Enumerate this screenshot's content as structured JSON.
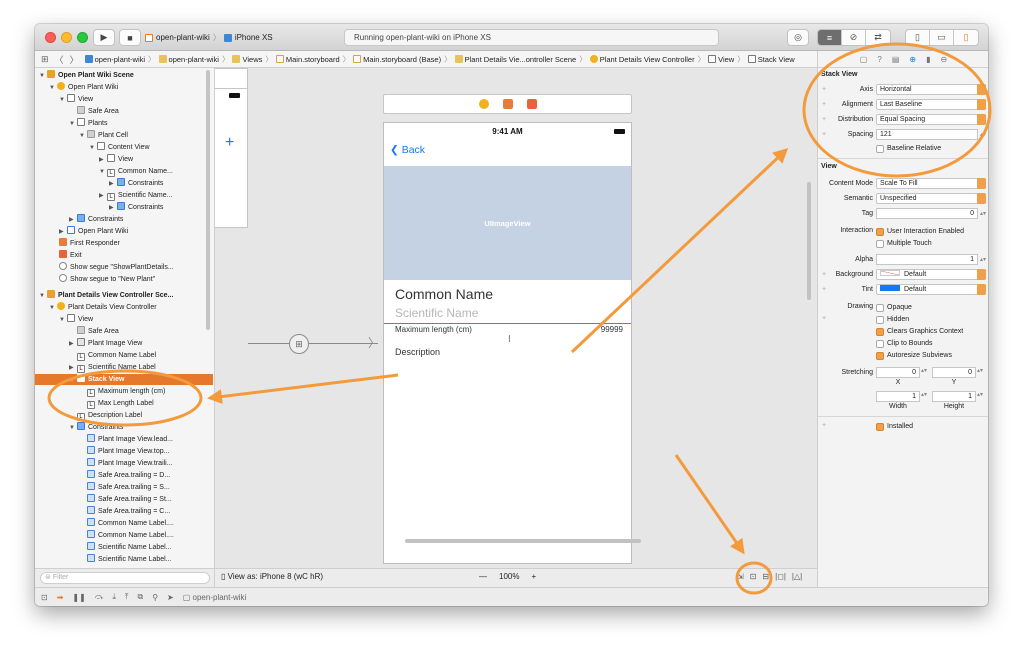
{
  "toolbar": {
    "scheme": "open-plant-wiki",
    "device": "iPhone XS",
    "status": "Running open-plant-wiki on iPhone XS"
  },
  "jumpbar": {
    "crumbs": [
      "open-plant-wiki",
      "open-plant-wiki",
      "Views",
      "Main.storyboard",
      "Main.storyboard (Base)",
      "Plant Details Vie...ontroller Scene",
      "Plant Details View Controller",
      "View",
      "Stack View"
    ]
  },
  "outline": {
    "rows": [
      "Open Plant Wiki Scene",
      "Open Plant Wiki",
      "View",
      "Safe Area",
      "Plants",
      "Plant Cell",
      "Content View",
      "View",
      "Common Name...",
      "Constraints",
      "Scientific Name...",
      "Constraints",
      "Constraints",
      "Open Plant Wiki",
      "First Responder",
      "Exit",
      "Show segue \"ShowPlantDetails...",
      "Show segue to \"New Plant\"",
      "Plant Details View Controller Sce...",
      "Plant Details View Controller",
      "View",
      "Safe Area",
      "Plant Image View",
      "Common Name Label",
      "Scientific Name Label",
      "Stack View",
      "Maximum length (cm)",
      "Max Length Label",
      "Description Label",
      "Constraints",
      "Plant Image View.lead...",
      "Plant Image View.top...",
      "Plant Image View.traili...",
      "Safe Area.trailing = D...",
      "Safe Area.trailing = S...",
      "Safe Area.trailing = St...",
      "Safe Area.trailing = C...",
      "Common Name Label....",
      "Common Name Label....",
      "Scientific Name Label...",
      "Scientific Name Label..."
    ],
    "filter_placeholder": "Filter"
  },
  "canvas": {
    "status_time": "9:41 AM",
    "back_label": "Back",
    "image_placeholder": "UIImageView",
    "common_name": "Common Name",
    "scientific_name": "Scientific Name",
    "max_length_label": "Maximum length (cm)",
    "max_length_value": "99999",
    "description": "Description",
    "view_as": "View as: iPhone 8 (wC hR)",
    "zoom": "100%",
    "zoom_minus": "—",
    "zoom_plus": "+"
  },
  "debug": {
    "target": "open-plant-wiki"
  },
  "inspector": {
    "stack_title": "Stack View",
    "axis_label": "Axis",
    "axis_value": "Horizontal",
    "alignment_label": "Alignment",
    "alignment_value": "Last Baseline",
    "distribution_label": "Distribution",
    "distribution_value": "Equal Spacing",
    "spacing_label": "Spacing",
    "spacing_value": "121",
    "baseline_relative": "Baseline Relative",
    "view_title": "View",
    "content_mode_label": "Content Mode",
    "content_mode_value": "Scale To Fill",
    "semantic_label": "Semantic",
    "semantic_value": "Unspecified",
    "tag_label": "Tag",
    "tag_value": "0",
    "interaction_label": "Interaction",
    "user_interaction": "User Interaction Enabled",
    "multiple_touch": "Multiple Touch",
    "alpha_label": "Alpha",
    "alpha_value": "1",
    "background_label": "Background",
    "background_value": "Default",
    "tint_label": "Tint",
    "tint_value": "Default",
    "drawing_label": "Drawing",
    "opaque": "Opaque",
    "hidden": "Hidden",
    "clears_graphics": "Clears Graphics Context",
    "clip_to_bounds": "Clip to Bounds",
    "autoresize": "Autoresize Subviews",
    "stretching_label": "Stretching",
    "stretch_x_value": "0",
    "stretch_y_value": "0",
    "stretch_w_value": "1",
    "stretch_h_value": "1",
    "x_cap": "X",
    "y_cap": "Y",
    "width_cap": "Width",
    "height_cap": "Height",
    "installed": "Installed"
  },
  "colors": {
    "accent_orange": "#e6782c",
    "annotation_orange": "#f39a3c",
    "ios_blue": "#1479f5"
  }
}
